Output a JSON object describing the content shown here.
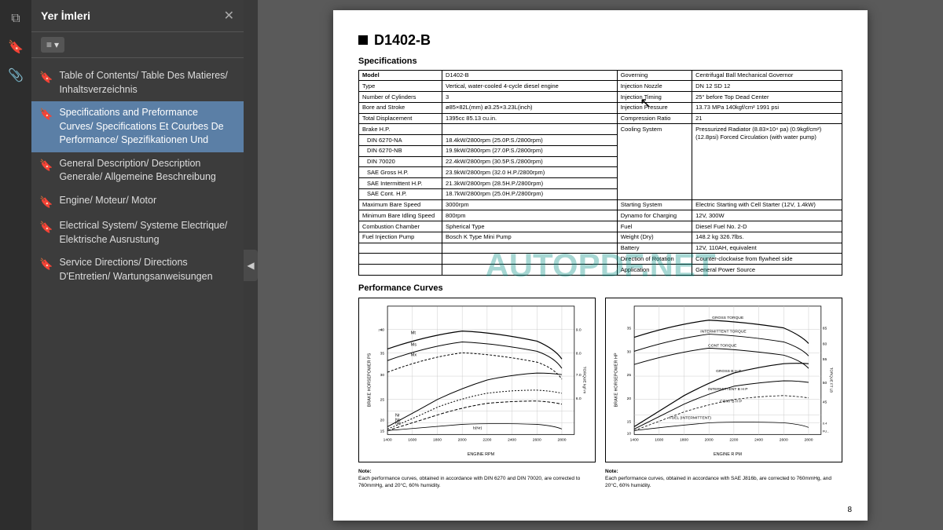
{
  "app": {
    "title": "Yer İmleri",
    "page_number": "8",
    "watermark": "AUTOPDF.NET"
  },
  "toolbar": {
    "icons": [
      {
        "name": "pages-icon",
        "symbol": "⧉",
        "active": false
      },
      {
        "name": "bookmarks-icon",
        "symbol": "🔖",
        "active": true
      },
      {
        "name": "attachments-icon",
        "symbol": "📎",
        "active": false
      }
    ]
  },
  "sidebar": {
    "title": "Yer İmleri",
    "view_btn": "≡ ▾",
    "items": [
      {
        "id": "toc",
        "label": "Table of Contents/ Table Des Matieres/ Inhaltsverzeichnis",
        "active": false
      },
      {
        "id": "specs",
        "label": "Specifications and Preformance Curves/ Specifications Et Courbes De Performance/ Spezifikationen Und",
        "active": true
      },
      {
        "id": "general",
        "label": "General Description/ Description Generale/ Allgemeine Beschreibung",
        "active": false
      },
      {
        "id": "engine",
        "label": "Engine/ Moteur/ Motor",
        "active": false
      },
      {
        "id": "electrical",
        "label": "Electrical System/ Systeme Electrique/ Elektrische Ausrustung",
        "active": false
      },
      {
        "id": "service",
        "label": "Service Directions/ Directions D'Entretien/ Wartungsanweisungen",
        "active": false
      }
    ]
  },
  "page": {
    "title": "D1402-B",
    "sections": {
      "specifications": "Specifications",
      "performance": "Performance Curves"
    },
    "spec_table": {
      "left": [
        [
          "Model",
          "D1402-B"
        ],
        [
          "Type",
          "Vertical, water-cooled 4-cycle diesel engine"
        ],
        [
          "Number of Cylinders",
          "3"
        ],
        [
          "Bore and Stroke",
          "ø85×82L(mm) ø3.25×3.23L(inch)"
        ],
        [
          "Total Displacement",
          "1395cc 85.13 cu.in."
        ],
        [
          "Brake H.P.",
          ""
        ],
        [
          "DIN 6270-NA",
          "18.4kW/2800rpm (25.0P.S./2800rpm)"
        ],
        [
          "DIN 6270-NB",
          "19.9kW/2800rpm (27.0P.S./2800rpm)"
        ],
        [
          "DIN 70020",
          "22.4kW/2800rpm (30.5P.S./2800rpm)"
        ],
        [
          "SAE Gross H.P.",
          "23.9kW/2800rpm (32.0 H.P./2800rpm)"
        ],
        [
          "SAE Intermittent H.P.",
          "21.3kW/2800rpm (28.5H.P./2800rpm)"
        ],
        [
          "SAE Cont. H.P.",
          "18.7kW/2800rpm (25.0H.P./2800rpm)"
        ],
        [
          "Maximum Bare Speed",
          "3000rpm"
        ],
        [
          "Minimum Bare Idling Speed",
          "800rpm"
        ],
        [
          "Combustion Chamber",
          "Spherical Type"
        ],
        [
          "Fuel Injection Pump",
          "Bosch K Type Mini Pump"
        ]
      ],
      "right": [
        [
          "Governing",
          "Centrifugal Ball Mechanical Governor"
        ],
        [
          "Injection Nozzle",
          "DN 12 SD 12"
        ],
        [
          "Injection Timing",
          "25° before Top Dead Center"
        ],
        [
          "Injection Pressure",
          "13.73 MPa 140kgf/cm² 1991 psi"
        ],
        [
          "Compression Ratio",
          "21"
        ],
        [
          "Cooling System",
          "Pressurized Radiator (8.83×10⁴ pa) (0.9kgf/cm²) (12.8psi) Forced Circulation (with water pump)"
        ],
        [
          "Starting System",
          "Electric Starting with Cell Starter (12V, 1.4kW)"
        ],
        [
          "Dynamo for Charging",
          "12V, 300W"
        ],
        [
          "Fuel",
          "Diesel Fuel No. 2-D"
        ],
        [
          "Weight (Dry)",
          "148.2 kg 326.7lbs."
        ],
        [
          "Battery",
          "12V, 110AH, equivalent"
        ],
        [
          "Direction of Rotation",
          "Counter-clockwise from flywheel side"
        ],
        [
          "Application",
          "General Power Source"
        ]
      ]
    },
    "notes": {
      "left": "Note:\nEach performance curves, obtained in accordance with DIN 6270 and DIN 70020, are corrected to 760mmHg, and 20°C, 60% humidity.",
      "right": "Note:\nEach performance curves, obtained in accordance with SAE J816b, are corrected to 760mmHg, and 20°C, 60% humidity."
    }
  }
}
